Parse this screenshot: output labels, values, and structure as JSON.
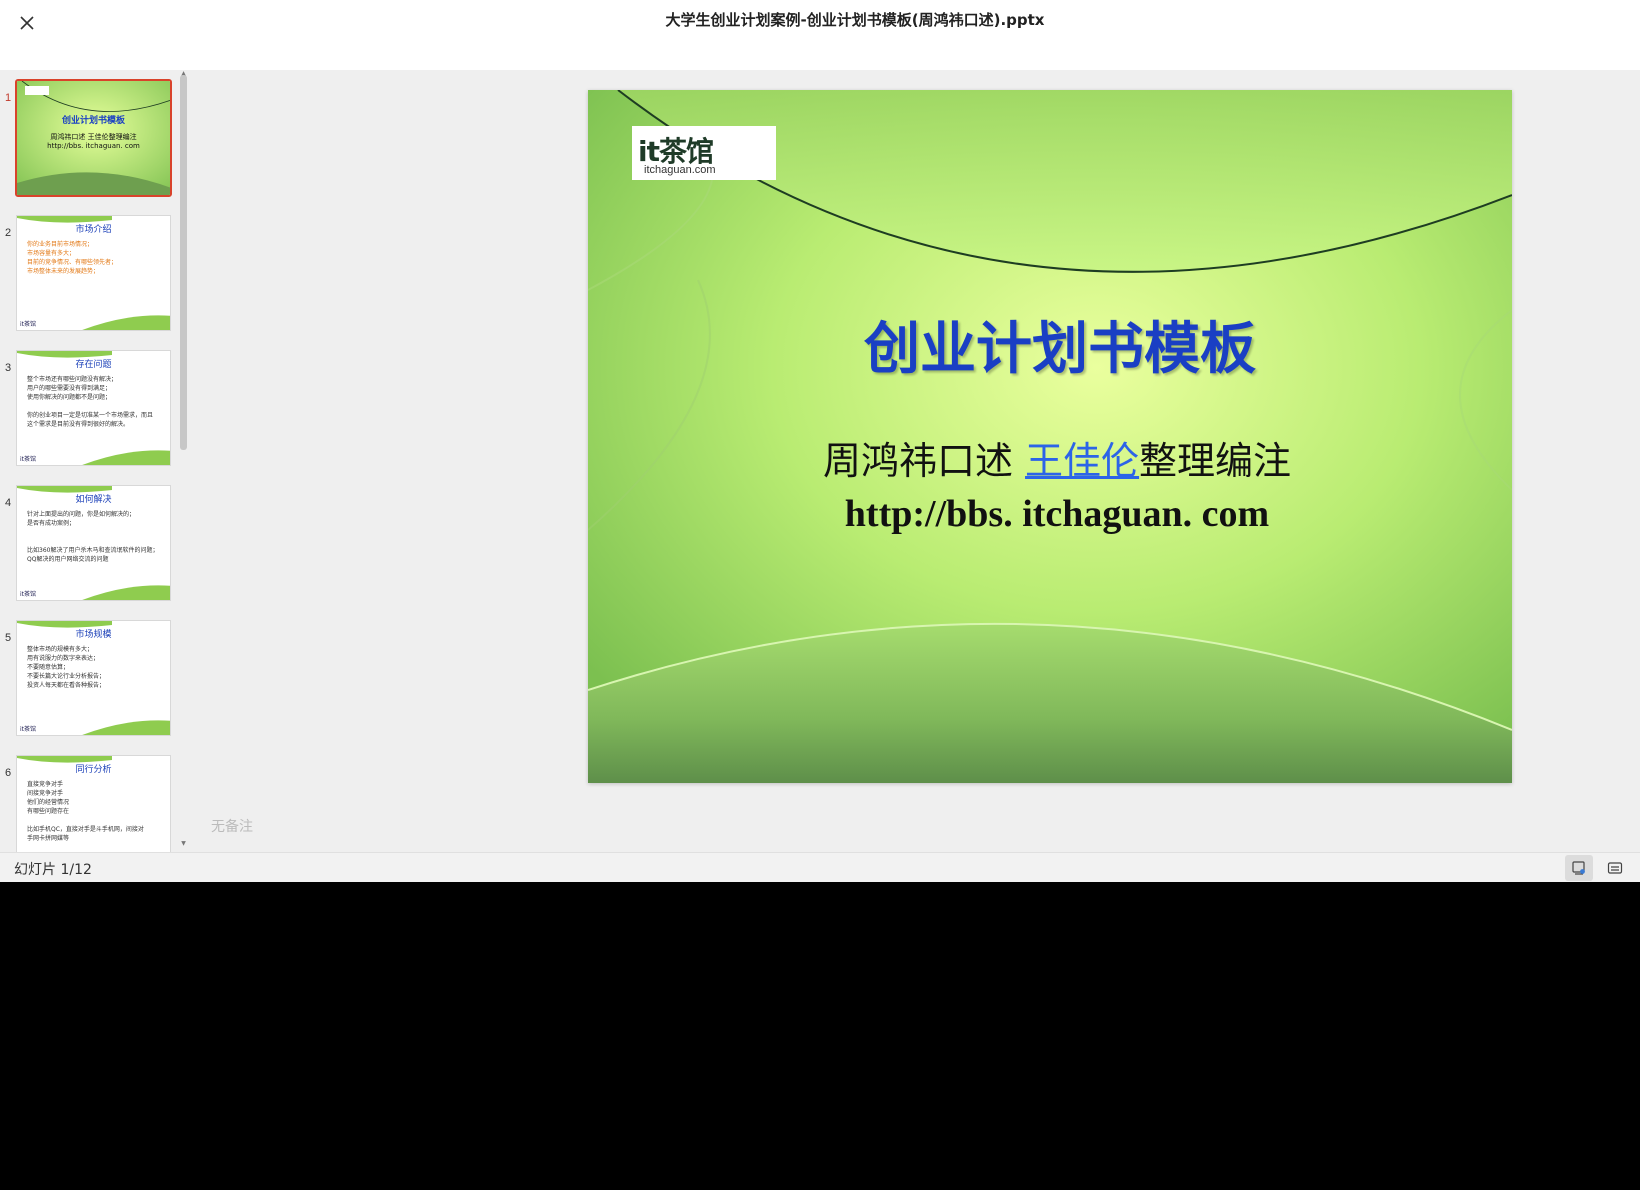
{
  "header": {
    "title": "大学生创业计划案例-创业计划书模板(周鸿祎口述).pptx"
  },
  "thumbnails": [
    {
      "num": "1",
      "title": "创业计划书模板",
      "lines": [
        "周鸿祎口述 王佳伦整理编注",
        "http://bbs. itchaguan. com"
      ]
    },
    {
      "num": "2",
      "title": "市场介绍",
      "lines": [
        "你的业务目前市场情况；",
        "市场容量有多大；",
        "目前的竞争情况、有哪些领先者；",
        "市场整体未来的发展趋势；"
      ]
    },
    {
      "num": "3",
      "title": "存在问题",
      "lines": [
        "整个市场还有哪些问题没有解决；",
        "用户的哪些需要没有得到满足；",
        "使用你解决的问题都不是问题；",
        "",
        "你的创业项目一定是切准某一个市场需求，而且",
        "这个需求是目前没有得到很好的解决。"
      ]
    },
    {
      "num": "4",
      "title": "如何解决",
      "lines": [
        "针对上面提出的问题，你是如何解决的；",
        "是否有成功案例；",
        "",
        "",
        "比如360解决了用户杀木马和查流氓软件的问题；",
        "QQ解决的用户网络交流的问题"
      ]
    },
    {
      "num": "5",
      "title": "市场规模",
      "lines": [
        "整体市场的规模有多大；",
        "用有说服力的数字来表达；",
        "不要随意估算；",
        "不要长篇大论行业分析报告；",
        "投资人每天都在看各种报告；"
      ]
    },
    {
      "num": "6",
      "title": "同行分析",
      "lines": [
        "直接竞争对手",
        "间接竞争对手",
        "他们的经营情况",
        "有哪些问题存在",
        "",
        "比如手机QC，直接对手是斗手机网，间接对",
        "手网卡拼网媒等"
      ]
    }
  ],
  "slide": {
    "logo_text": "it茶馆",
    "logo_sub": "itchaguan.com",
    "title": "创业计划书模板",
    "subtitle_before": "周鸿祎口述 ",
    "subtitle_link": "王佳伦",
    "subtitle_after": "整理编注",
    "url": "http://bbs. itchaguan. com"
  },
  "notes": "无备注",
  "status": {
    "slide_count": "幻灯片 1/12"
  },
  "icons": {
    "close": "close-icon",
    "notes_view": "notes-view-icon",
    "subtitles": "subtitle-icon"
  },
  "colors": {
    "accent": "#d9432b",
    "title_blue": "#1a3fc4",
    "link_blue": "#2c64e8"
  }
}
